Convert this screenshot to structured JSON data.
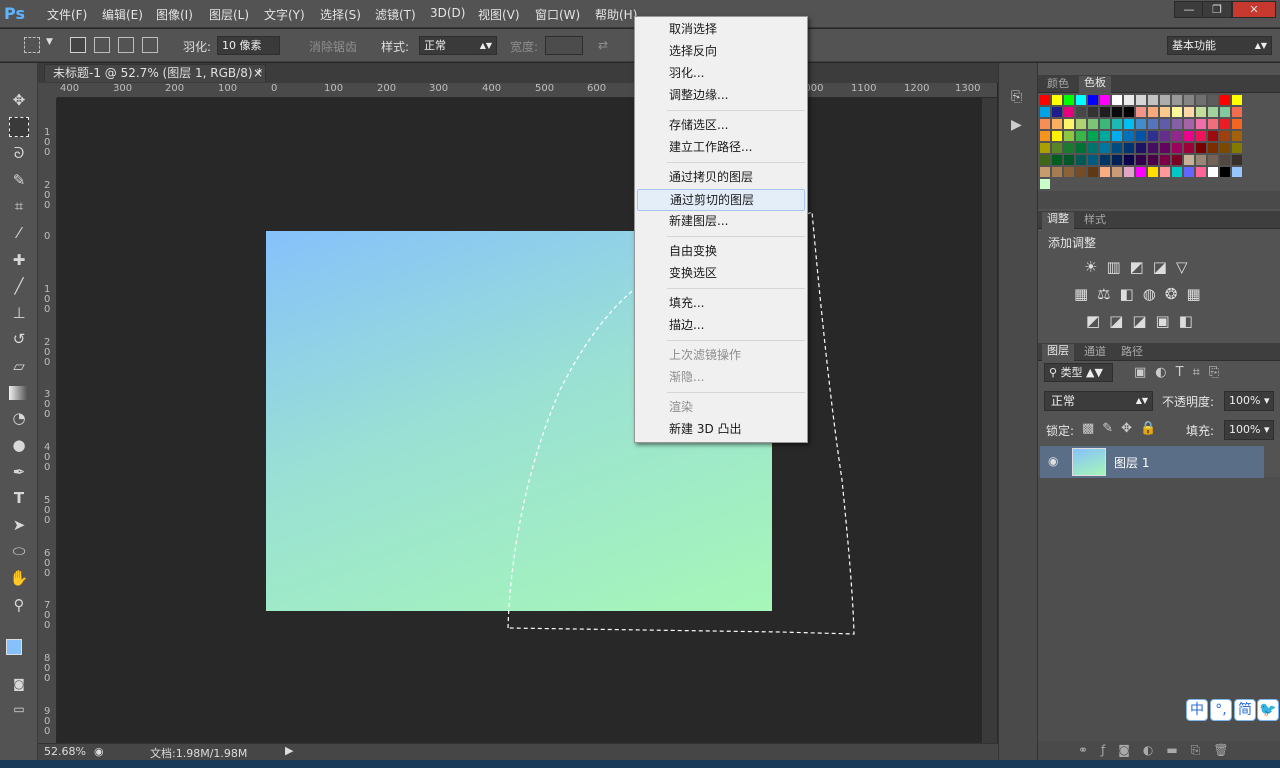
{
  "app": {
    "logo": "Ps"
  },
  "menu": [
    "文件(F)",
    "编辑(E)",
    "图像(I)",
    "图层(L)",
    "文字(Y)",
    "选择(S)",
    "滤镜(T)",
    "3D(D)",
    "视图(V)",
    "窗口(W)",
    "帮助(H)"
  ],
  "window_controls": {
    "minimize": "—",
    "restore": "❐",
    "close": "✕"
  },
  "options": {
    "feather_label": "羽化:",
    "feather_value": "10 像素",
    "antialias_label": "消除锯齿",
    "style_label": "样式:",
    "style_value": "正常",
    "width_label": "宽度:",
    "workspace_value": "基本功能"
  },
  "document": {
    "tab_title": "未标题-1 @ 52.7% (图层 1, RGB/8) *",
    "tab_close": "×",
    "zoom": "52.68%",
    "doc_info": "文档:1.98M/1.98M"
  },
  "ruler_top": [
    "400",
    "300",
    "200",
    "100",
    "0",
    "100",
    "200",
    "300",
    "400",
    "500",
    "600",
    "1000",
    "1100",
    "1200",
    "1300"
  ],
  "ruler_left": [
    "1\n0\n0",
    "2\n0\n0",
    "0",
    "1\n0\n0",
    "2\n0\n0",
    "3\n0\n0",
    "4\n0\n0",
    "5\n0\n0",
    "6\n0\n0",
    "7\n0\n0",
    "8\n0\n0",
    "9\n0\n0"
  ],
  "context_menu": {
    "items": [
      {
        "label": "取消选择"
      },
      {
        "label": "选择反向"
      },
      {
        "label": "羽化..."
      },
      {
        "label": "调整边缘..."
      },
      {
        "label": "存储选区..."
      },
      {
        "label": "建立工作路径..."
      },
      {
        "label": "通过拷贝的图层"
      },
      {
        "label": "通过剪切的图层"
      },
      {
        "label": "新建图层..."
      },
      {
        "label": "自由变换"
      },
      {
        "label": "变换选区"
      },
      {
        "label": "填充..."
      },
      {
        "label": "描边..."
      },
      {
        "label": "上次滤镜操作"
      },
      {
        "label": "渐隐..."
      },
      {
        "label": "渲染"
      },
      {
        "label": "新建 3D 凸出"
      }
    ],
    "hovered": "通过剪切的图层"
  },
  "panels": {
    "color_tabs": [
      "颜色",
      "色板"
    ],
    "adjust_tabs": [
      "调整",
      "样式"
    ],
    "adjust_title": "添加调整",
    "layer_tabs": [
      "图层",
      "通道",
      "路径"
    ],
    "filter_kind": "类型",
    "blend_mode": "正常",
    "opacity_label": "不透明度:",
    "opacity_value": "100%",
    "lock_label": "锁定:",
    "fill_label": "填充:",
    "fill_value": "100%",
    "layer_name": "图层 1"
  },
  "ime": [
    "中",
    "°,",
    "简",
    "🐦"
  ],
  "swatches": [
    "#ff0000",
    "#ffff00",
    "#00ff00",
    "#00ffff",
    "#0000ff",
    "#ff00ff",
    "#ffffff",
    "#ebebeb",
    "#d6d6d6",
    "#c2c2c2",
    "#adadad",
    "#999999",
    "#858585",
    "#707070",
    "#5c5c5c",
    "#ff0000",
    "#ffff00",
    "#00a2e8",
    "#1e1e8c",
    "#e4007f",
    "#474747",
    "#333333",
    "#1f1f1f",
    "#0a0a0a",
    "#000000",
    "#f2948a",
    "#f6a97a",
    "#fbca8c",
    "#fff799",
    "#ffd8a8",
    "#c4df9b",
    "#a3d39c",
    "#82ca9c",
    "#f26c4f",
    "#f68e55",
    "#fbaf5c",
    "#fff467",
    "#acd372",
    "#7cc576",
    "#3bb878",
    "#1abbb4",
    "#00bff3",
    "#438ccb",
    "#5574b9",
    "#605ca8",
    "#855fa8",
    "#a763a9",
    "#f06ea9",
    "#f26d7d",
    "#ed1c24",
    "#f26522",
    "#f7941d",
    "#fff200",
    "#8dc63f",
    "#39b54a",
    "#00a651",
    "#00a99d",
    "#00aeef",
    "#0072bc",
    "#0054a6",
    "#2e3192",
    "#662d91",
    "#92278f",
    "#ec008c",
    "#ed145b",
    "#9e0b0f",
    "#a0410d",
    "#a36209",
    "#aba000",
    "#598527",
    "#1a7b30",
    "#007236",
    "#00746b",
    "#0076a3",
    "#004b80",
    "#003471",
    "#1b1464",
    "#440e62",
    "#630460",
    "#9e005d",
    "#9e0039",
    "#790000",
    "#7b2e00",
    "#7d4900",
    "#827b00",
    "#406618",
    "#005e20",
    "#005826",
    "#005952",
    "#005b7f",
    "#003663",
    "#002157",
    "#0d004c",
    "#32004b",
    "#4b0049",
    "#7b0046",
    "#7a0026",
    "#c7b299",
    "#998675",
    "#736357",
    "#534741",
    "#37302a",
    "#c69c6d",
    "#a67c52",
    "#8c6239",
    "#754c24",
    "#603813",
    "#f9ad81",
    "#ca9b78",
    "#e0a4c4",
    "#ff00ff",
    "#ffde00",
    "#ff9999",
    "#00c8c8",
    "#6464ff",
    "#ff6496",
    "#ffffff",
    "#000000",
    "#96c8ff",
    "#c8ffc8"
  ]
}
